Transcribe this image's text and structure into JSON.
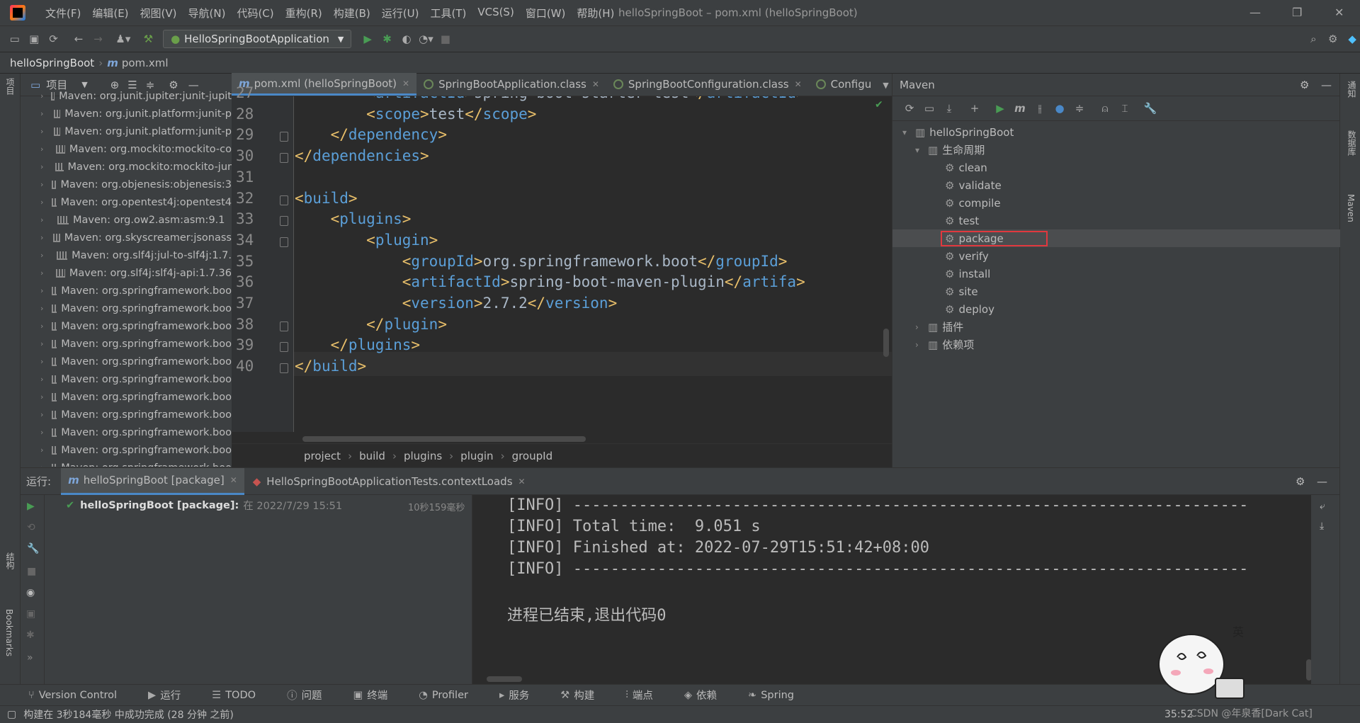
{
  "window": {
    "title": "helloSpringBoot – pom.xml (helloSpringBoot)"
  },
  "menu": [
    "文件(F)",
    "编辑(E)",
    "视图(V)",
    "导航(N)",
    "代码(C)",
    "重构(R)",
    "构建(B)",
    "运行(U)",
    "工具(T)",
    "VCS(S)",
    "窗口(W)",
    "帮助(H)"
  ],
  "toolbar": {
    "run_config": "HelloSpringBootApplication"
  },
  "breadcrumb": {
    "project": "helloSpringBoot",
    "file": "pom.xml"
  },
  "left_strip": {
    "project": "项目",
    "structure": "结构",
    "bookmarks": "Bookmarks"
  },
  "right_strip": {
    "notifications": "通知",
    "database": "数据库",
    "maven": "Maven"
  },
  "project_panel": {
    "title": "项目",
    "items": [
      "Maven: org.junit.jupiter:junit-jupit",
      "Maven: org.junit.platform:junit-p",
      "Maven: org.junit.platform:junit-p",
      "Maven: org.mockito:mockito-co",
      "Maven: org.mockito:mockito-jur",
      "Maven: org.objenesis:objenesis:3",
      "Maven: org.opentest4j:opentest4",
      "Maven: org.ow2.asm:asm:9.1",
      "Maven: org.skyscreamer:jsonass",
      "Maven: org.slf4j:jul-to-slf4j:1.7.",
      "Maven: org.slf4j:slf4j-api:1.7.36",
      "Maven: org.springframework.boo",
      "Maven: org.springframework.boo",
      "Maven: org.springframework.boo",
      "Maven: org.springframework.boo",
      "Maven: org.springframework.boo",
      "Maven: org.springframework.boo",
      "Maven: org.springframework.boo",
      "Maven: org.springframework.boo",
      "Maven: org.springframework.boo",
      "Maven: org.springframework.boo",
      "Maven: org.springframework.boo"
    ]
  },
  "editor": {
    "tabs": [
      {
        "label": "pom.xml (helloSpringBoot)",
        "active": true
      },
      {
        "label": "SpringBootApplication.class"
      },
      {
        "label": "SpringBootConfiguration.class"
      },
      {
        "label": "Configu"
      }
    ],
    "lines": [
      {
        "n": "27",
        "indent": "        ",
        "open": "artifactId",
        "text": "spring-boot-starter-test",
        "close": "artifactId"
      },
      {
        "n": "28",
        "indent": "        ",
        "open": "scope",
        "text": "test",
        "close": "scope"
      },
      {
        "n": "29",
        "indent": "    ",
        "close": "dependency"
      },
      {
        "n": "30",
        "indent": "",
        "close": "dependencies"
      },
      {
        "n": "31",
        "indent": ""
      },
      {
        "n": "32",
        "indent": "",
        "open": "build"
      },
      {
        "n": "33",
        "indent": "    ",
        "open": "plugins"
      },
      {
        "n": "34",
        "indent": "        ",
        "open": "plugin"
      },
      {
        "n": "35",
        "indent": "            ",
        "open": "groupId",
        "text": "org.springframework.boot",
        "close": "groupId"
      },
      {
        "n": "36",
        "indent": "            ",
        "open": "artifactId",
        "text": "spring-boot-maven-plugin",
        "close": "artifa"
      },
      {
        "n": "37",
        "indent": "            ",
        "open": "version",
        "text": "2.7.2",
        "close": "version"
      },
      {
        "n": "38",
        "indent": "        ",
        "close": "plugin"
      },
      {
        "n": "39",
        "indent": "    ",
        "close": "plugins"
      },
      {
        "n": "40",
        "indent": "",
        "close": "build"
      }
    ],
    "crumbs": [
      "project",
      "build",
      "plugins",
      "plugin",
      "groupId"
    ]
  },
  "maven": {
    "title": "Maven",
    "root": "helloSpringBoot",
    "lifecycle": "生命周期",
    "goals": [
      "clean",
      "validate",
      "compile",
      "test",
      "package",
      "verify",
      "install",
      "site",
      "deploy"
    ],
    "selected": "package",
    "plugins": "插件",
    "dependencies": "依赖项"
  },
  "run": {
    "label": "运行:",
    "tabs": [
      "helloSpringBoot [package]",
      "HelloSpringBootApplicationTests.contextLoads"
    ],
    "tree": {
      "name": "helloSpringBoot [package]:",
      "when": "在 2022/7/29 15:51",
      "duration": "10秒159毫秒"
    },
    "console": [
      "[INFO] ------------------------------------------------------------------------",
      "[INFO] Total time:  9.051 s",
      "[INFO] Finished at: 2022-07-29T15:51:42+08:00",
      "[INFO] ------------------------------------------------------------------------",
      "",
      "进程已结束,退出代码0"
    ]
  },
  "bottom_tabs": [
    "Version Control",
    "运行",
    "TODO",
    "问题",
    "终端",
    "Profiler",
    "服务",
    "构建",
    "端点",
    "依赖",
    "Spring"
  ],
  "status": {
    "message": "构建在 3秒184毫秒 中成功完成 (28 分钟 之前)",
    "position": "35:52",
    "watermark": "CSDN @年泉香[Dark Cat]"
  },
  "colors": {
    "accent": "#4a88c7",
    "selection_box": "#e0383e",
    "run_green": "#499c54",
    "xml_tag": "#5b9fd8"
  }
}
